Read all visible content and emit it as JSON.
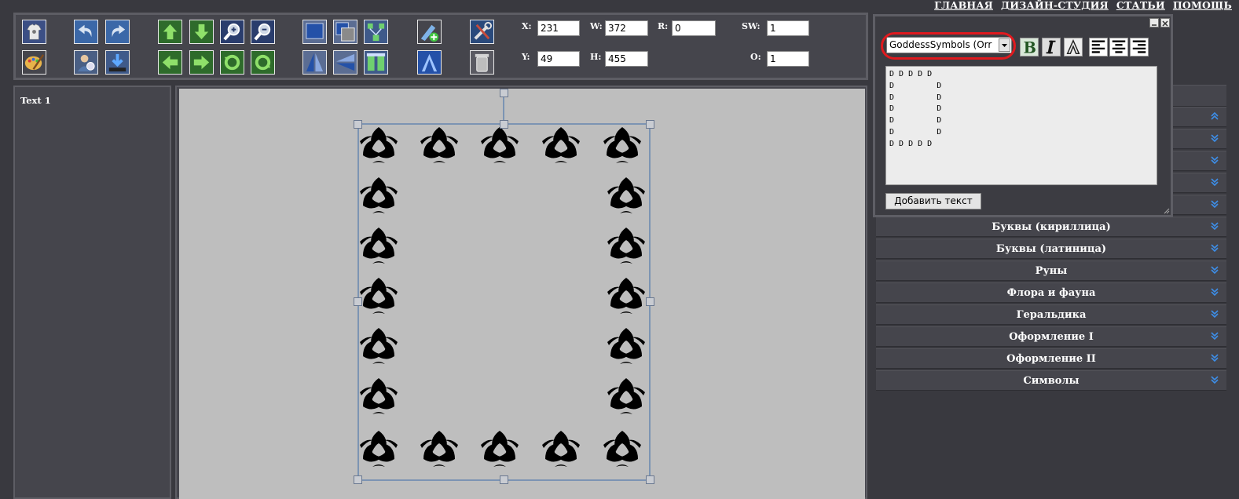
{
  "nav": {
    "items": [
      "ГЛАВНАЯ",
      "ДИЗАЙН-СТУДИЯ",
      "СТАТЬИ",
      "ПОМОЩЬ"
    ]
  },
  "toolbar": {
    "fields": {
      "x": {
        "label": "X:",
        "value": "231"
      },
      "w": {
        "label": "W:",
        "value": "372"
      },
      "r": {
        "label": "R:",
        "value": "0"
      },
      "sw": {
        "label": "SW:",
        "value": "1"
      },
      "y": {
        "label": "Y:",
        "value": "49"
      },
      "h": {
        "label": "H:",
        "value": "455"
      },
      "o": {
        "label": "O:",
        "value": "1"
      }
    }
  },
  "layers": {
    "items": [
      "Text 1"
    ]
  },
  "categories": [
    "Буквы (кириллица)",
    "Буквы (латиница)",
    "Руны",
    "Флора и фауна",
    "Геральдика",
    "Оформление I",
    "Оформление II",
    "Символы"
  ],
  "text_dialog": {
    "font_select": "GoddessSymbols (Orr",
    "text_content": "D D D D D\nD         D\nD         D\nD         D\nD         D\nD         D\nD D D D D",
    "add_button": "Добавить текст"
  },
  "colors": {
    "accent_highlight": "#e0191e",
    "panel_bg": "#45454c",
    "canvas_bg": "#bebebe"
  }
}
